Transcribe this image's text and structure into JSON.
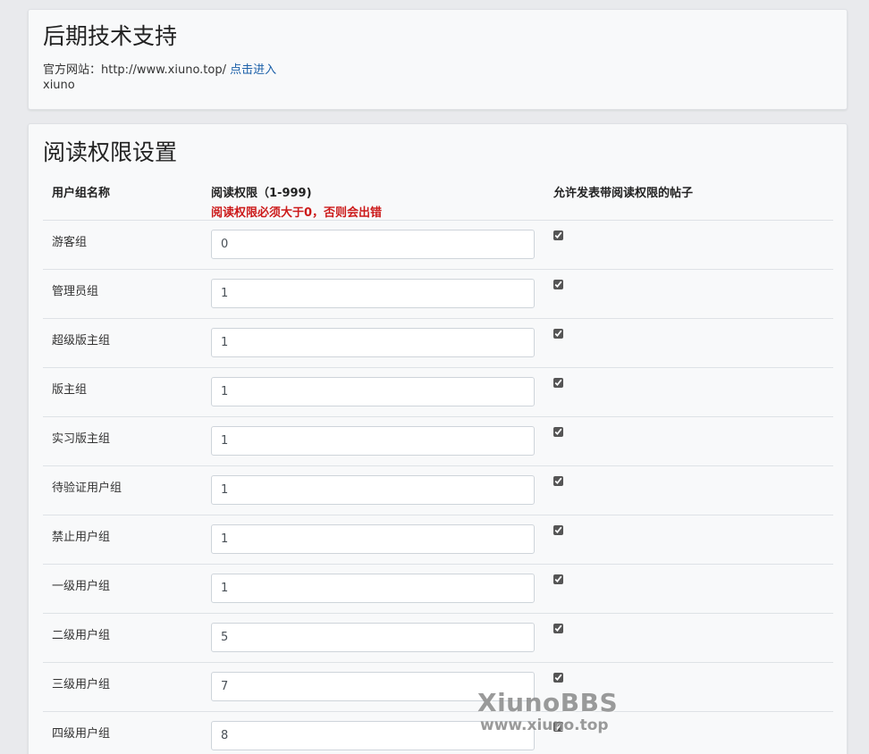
{
  "support": {
    "title": "后期技术支持",
    "site_label": "官方网站：http://www.xiuno.top/",
    "site_link": "点击进入",
    "author": "xiuno"
  },
  "permissions": {
    "title": "阅读权限设置",
    "headers": {
      "group_name": "用户组名称",
      "read_permission": "阅读权限（1-999)",
      "read_warning": "阅读权限必须大于0，否则会出错",
      "allow_post": "允许发表带阅读权限的帖子"
    },
    "rows": [
      {
        "group": "游客组",
        "value": "0",
        "allowed": true
      },
      {
        "group": "管理员组",
        "value": "1",
        "allowed": true
      },
      {
        "group": "超级版主组",
        "value": "1",
        "allowed": true
      },
      {
        "group": "版主组",
        "value": "1",
        "allowed": true
      },
      {
        "group": "实习版主组",
        "value": "1",
        "allowed": true
      },
      {
        "group": "待验证用户组",
        "value": "1",
        "allowed": true
      },
      {
        "group": "禁止用户组",
        "value": "1",
        "allowed": true
      },
      {
        "group": "一级用户组",
        "value": "1",
        "allowed": true
      },
      {
        "group": "二级用户组",
        "value": "5",
        "allowed": true
      },
      {
        "group": "三级用户组",
        "value": "7",
        "allowed": true
      },
      {
        "group": "四级用户组",
        "value": "8",
        "allowed": true
      }
    ]
  },
  "watermark": {
    "brand": "XiunoBBS",
    "url": "www.xiuno.top"
  }
}
